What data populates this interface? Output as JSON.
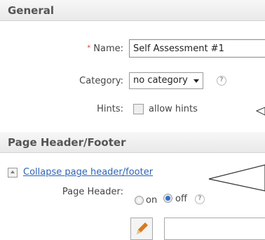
{
  "general": {
    "title": "General",
    "name_label": "Name:",
    "required_marker": "*",
    "name_value": "Self Assessment #1",
    "category_label": "Category:",
    "category_value": "no category",
    "hints_label": "Hints:",
    "hints_option": "allow hints"
  },
  "page_header_footer": {
    "title": "Page Header/Footer",
    "collapse_link": "Collapse page header/footer",
    "page_header_label": "Page Header:",
    "on_label": "on",
    "off_label": "off",
    "selected": "off"
  },
  "icons": {
    "help": "question-circle-icon",
    "collapse": "collapse-arrow-icon",
    "edit": "pencil-icon"
  },
  "colors": {
    "link": "#2d64b3",
    "required": "#e03c3c",
    "radio_selected": "#2e6fcf",
    "pencil": "#d97a1e"
  }
}
